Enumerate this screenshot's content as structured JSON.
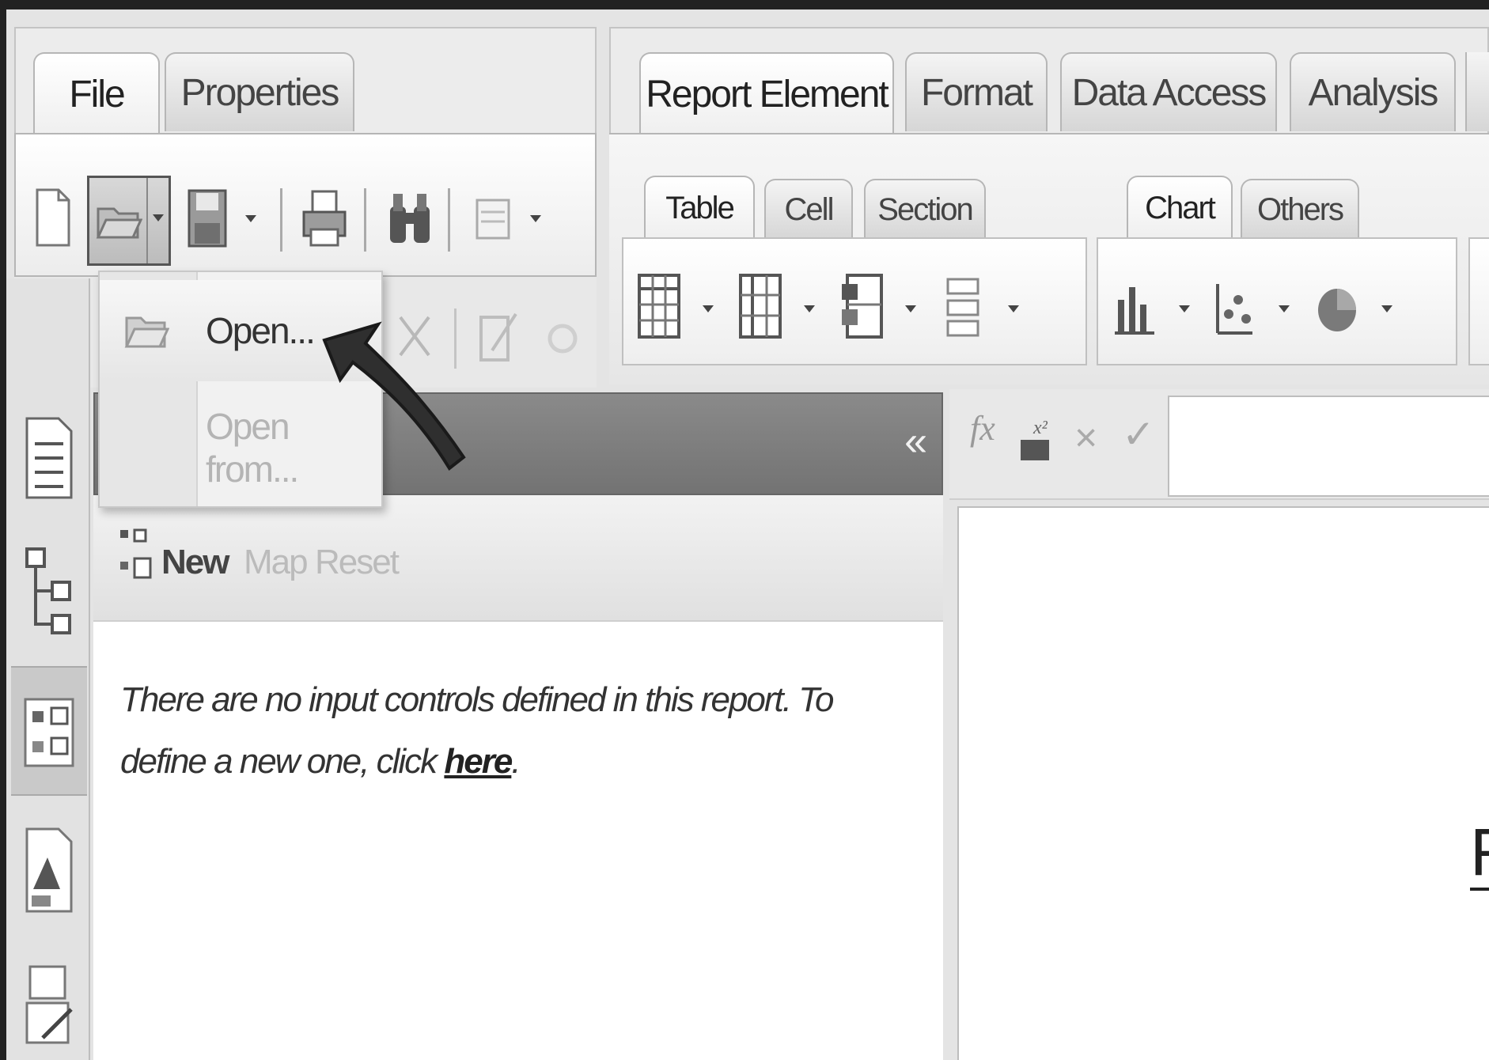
{
  "file_tabs": {
    "file": "File",
    "properties": "Properties"
  },
  "main_tabs": {
    "report_element": "Report Element",
    "format": "Format",
    "data_access": "Data Access",
    "analysis": "Analysis"
  },
  "sub_tabs": {
    "table": "Table",
    "cell": "Cell",
    "section": "Section",
    "chart": "Chart",
    "others": "Others"
  },
  "open_menu": {
    "open": "Open...",
    "open_from": "Open from..."
  },
  "input_controls": {
    "collapse_glyph": "«",
    "new": "New",
    "map": "Map",
    "reset": "Reset",
    "message": "There are no input controls defined in this report. To define a new one, click",
    "link": "here",
    "message_end": "."
  },
  "formula_bar": {
    "fx": "fx",
    "cancel": "×",
    "confirm": "✓"
  },
  "canvas": {
    "partial_text": "R"
  }
}
